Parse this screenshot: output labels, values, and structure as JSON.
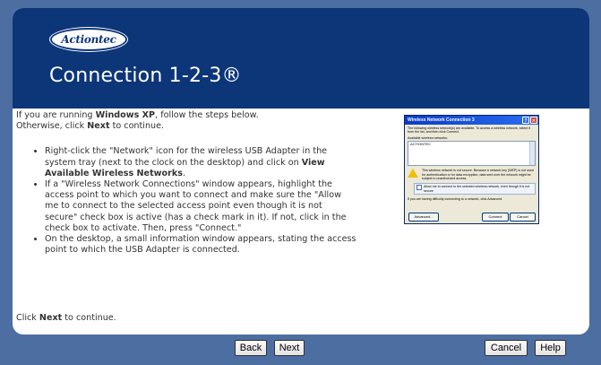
{
  "header": {
    "logo_text": "Actiontec",
    "title": "Connection 1-2-3®"
  },
  "intro": {
    "line1_pre": "If you are running ",
    "line1_bold": "Windows XP",
    "line1_post": ", follow the steps below.",
    "line2_pre": "Otherwise, click ",
    "line2_bold": "Next",
    "line2_post": " to continue."
  },
  "steps": [
    {
      "pre": "Right-click the \"Network\" icon for the wireless USB Adapter in the system tray (next to the clock on the desktop) and click on ",
      "bold": "View Available Wireless Networks",
      "post": "."
    },
    {
      "text": "If a \"Wireless Network Connections\" window appears, highlight the access point to which you want to connect and make sure the \"Allow me to connect to the selected access point even though it is not secure\" check box is active (has a check mark in it). If not, click in the check box to activate. Then, press \"Connect.\""
    },
    {
      "text": "On the desktop, a small information window appears, stating the access point to which the USB Adapter is connected."
    }
  ],
  "footer_note": {
    "pre": "Click ",
    "bold": "Next",
    "post": " to continue."
  },
  "dialog": {
    "title": "Wireless Network Connection 3",
    "help_glyph": "?",
    "close_glyph": "✕",
    "desc": "The following wireless network(s) are available. To access a wireless network, select it from the list, and then click Connect.",
    "list_label": "Available wireless networks:",
    "network": "ACTIONTEC",
    "warning": "This wireless network is not secure. Because a network key (WEP) is not used for authentication or for data encryption, data sent over the network might be subject to unauthorized access.",
    "checkbox": "Allow me to connect to the selected wireless network, even though it is not secure",
    "help_text": "If you are having difficulty connecting to a network, click Advanced.",
    "btn_advanced": "Advanced...",
    "btn_connect": "Connect",
    "btn_cancel": "Cancel"
  },
  "buttons": {
    "back": "Back",
    "next": "Next",
    "cancel": "Cancel",
    "help": "Help"
  }
}
